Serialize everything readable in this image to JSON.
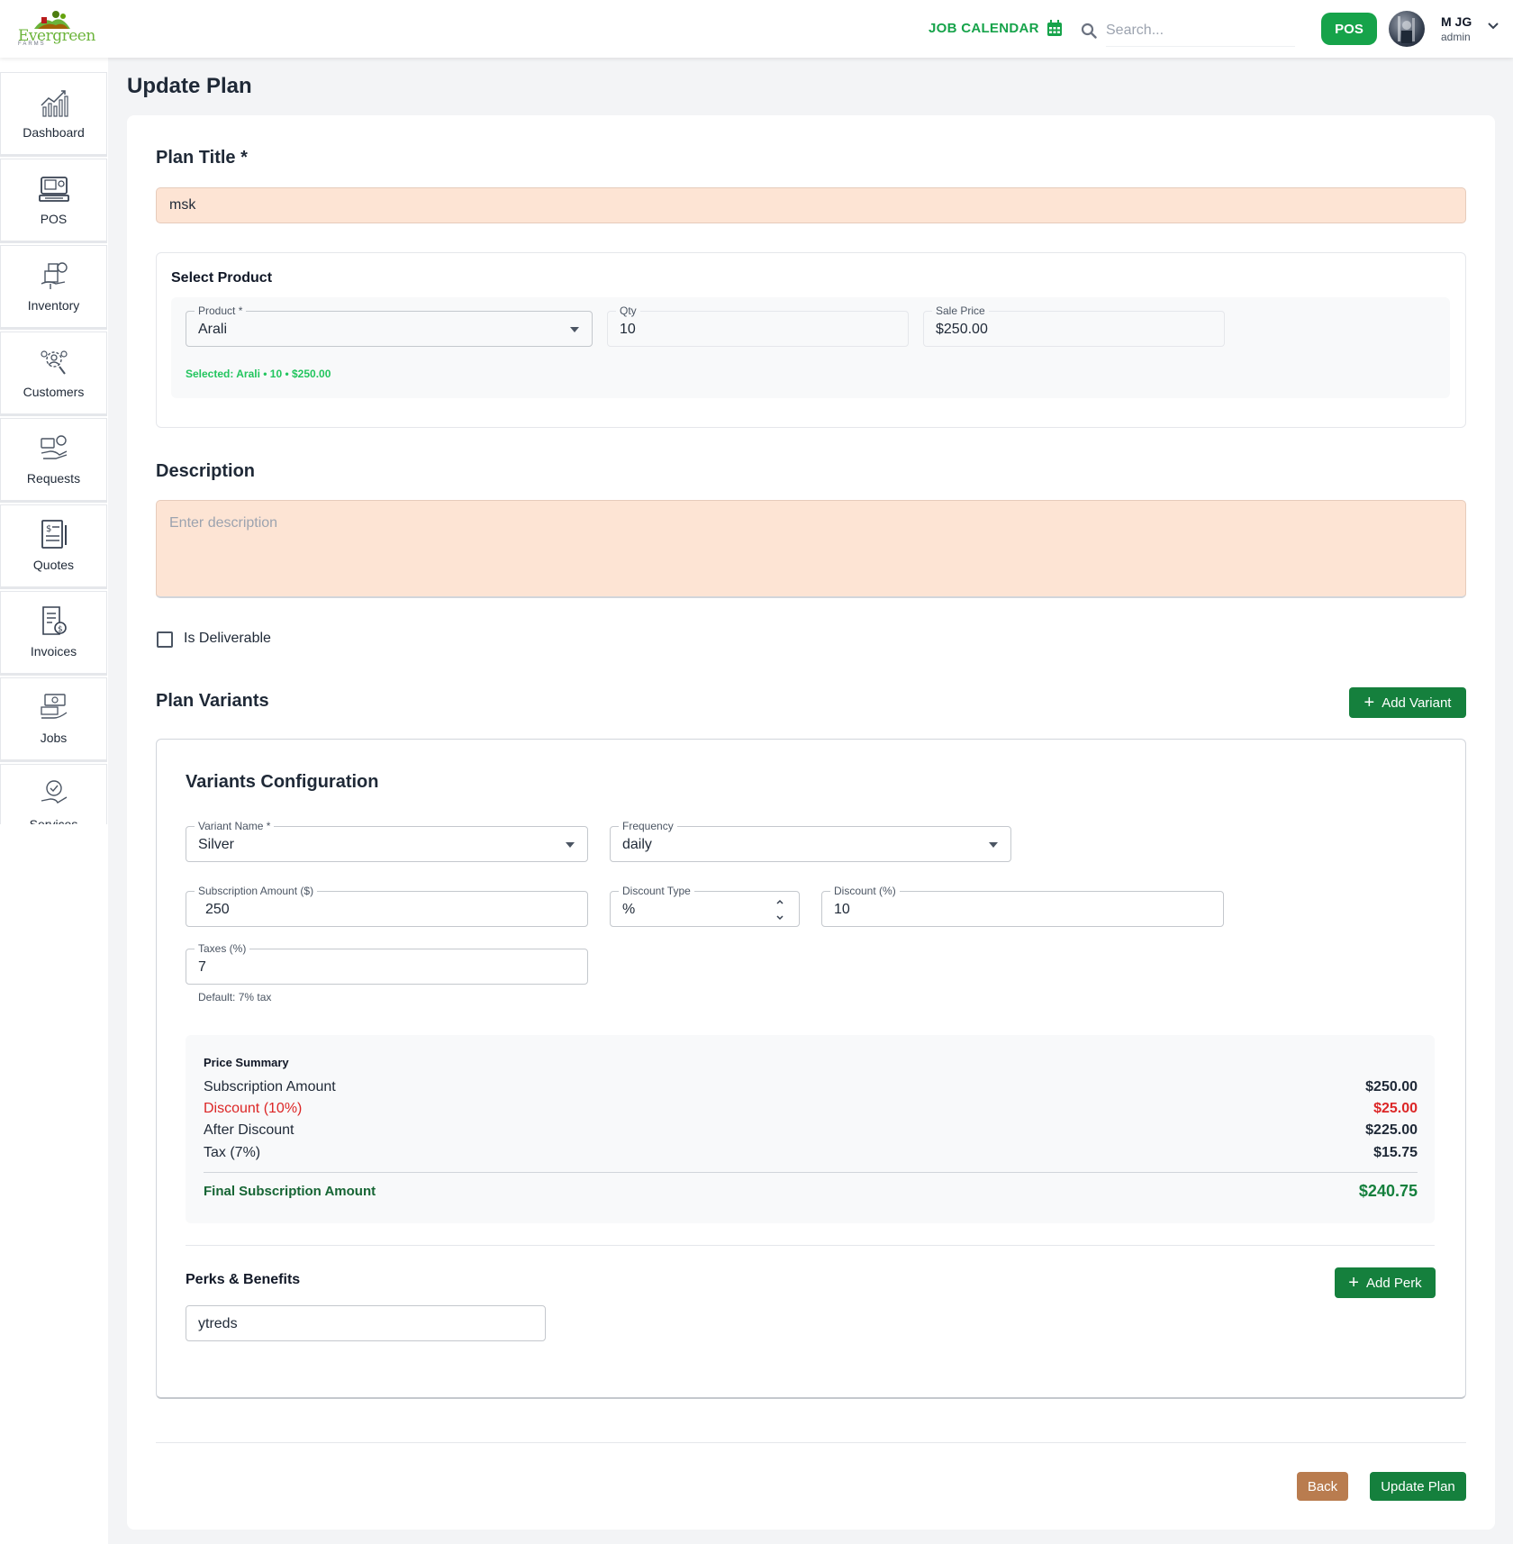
{
  "header": {
    "logo_text": "Evergreen",
    "logo_sub": "FARMS",
    "job_calendar_label": "JOB CALENDAR",
    "search_placeholder": "Search...",
    "pos_label": "POS",
    "user_name": "M JG",
    "user_role": "admin"
  },
  "sidebar": {
    "items": [
      {
        "label": "Dashboard",
        "icon": "chart-bars-icon"
      },
      {
        "label": "POS",
        "icon": "pos-register-icon"
      },
      {
        "label": "Inventory",
        "icon": "inventory-boxes-icon"
      },
      {
        "label": "Customers",
        "icon": "customers-gear-icon"
      },
      {
        "label": "Requests",
        "icon": "requests-hand-icon"
      },
      {
        "label": "Quotes",
        "icon": "quote-document-icon"
      },
      {
        "label": "Invoices",
        "icon": "invoice-document-icon"
      },
      {
        "label": "Jobs",
        "icon": "jobs-cash-icon"
      },
      {
        "label": "Services",
        "icon": "services-hand-icon"
      }
    ]
  },
  "page": {
    "title": "Update Plan",
    "plan_title_label": "Plan Title *",
    "plan_title_value": "msk",
    "select_product": {
      "heading": "Select Product",
      "product_label": "Product *",
      "product_value": "Arali",
      "qty_label": "Qty",
      "qty_value": "10",
      "sale_price_label": "Sale Price",
      "sale_price_value": "$250.00",
      "selected_text": "Selected: Arali • 10 • $250.00"
    },
    "description_label": "Description",
    "description_placeholder": "Enter description",
    "is_deliverable_label": "Is Deliverable",
    "plan_variants_label": "Plan Variants",
    "add_variant_label": "Add Variant",
    "variants": {
      "heading": "Variants Configuration",
      "variant_name_label": "Variant Name *",
      "variant_name_value": "Silver",
      "frequency_label": "Frequency",
      "frequency_value": "daily",
      "subscription_amount_label": "Subscription Amount ($)",
      "subscription_amount_value": "250",
      "discount_type_label": "Discount Type",
      "discount_type_value": "%",
      "discount_label": "Discount (%)",
      "discount_value": "10",
      "taxes_label": "Taxes (%)",
      "taxes_value": "7",
      "taxes_helper": "Default: 7% tax"
    },
    "price_summary": {
      "heading": "Price Summary",
      "rows": [
        {
          "label": "Subscription Amount",
          "amount": "$250.00"
        },
        {
          "label": "Discount (10%)",
          "amount": "$25.00"
        },
        {
          "label": "After Discount",
          "amount": "$225.00"
        },
        {
          "label": "Tax (7%)",
          "amount": "$15.75"
        }
      ],
      "final_label": "Final Subscription Amount",
      "final_amount": "$240.75"
    },
    "perks": {
      "heading": "Perks & Benefits",
      "add_perk_label": "Add Perk",
      "perk_value": "ytreds"
    },
    "back_label": "Back",
    "update_label": "Update Plan"
  },
  "colors": {
    "primary_green": "#15803d",
    "bright_green": "#16a34a",
    "peach_input": "#fde4d4",
    "discount_red": "#dc2626",
    "back_brown": "#b97c4f"
  }
}
